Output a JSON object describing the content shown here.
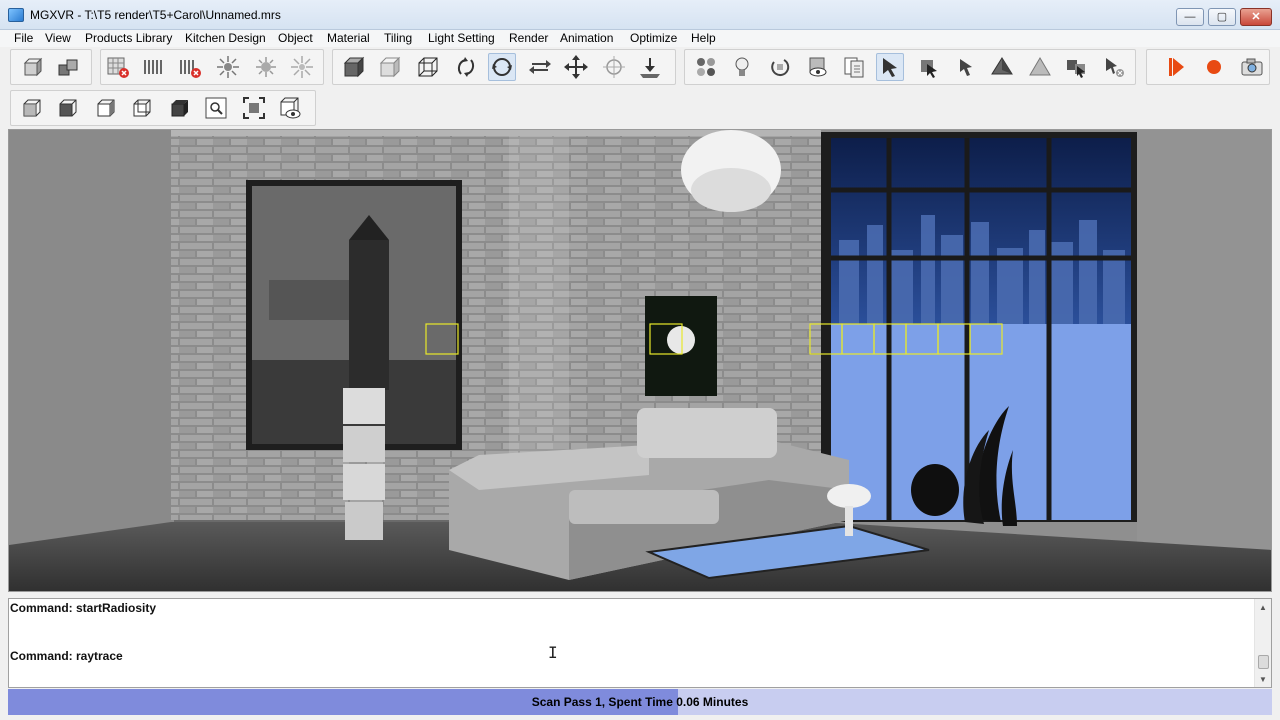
{
  "window": {
    "title": "MGXVR - T:\\T5 render\\T5+Carol\\Unnamed.mrs",
    "minimize": "—",
    "restore": "▢",
    "close": "✕"
  },
  "menu": [
    "File",
    "View",
    "Products Library",
    "Kitchen Design",
    "Object",
    "Material",
    "Tiling",
    "Light Setting",
    "Render",
    "Animation",
    "Optimize",
    "Help"
  ],
  "console": {
    "lines": [
      "Command: startRadiosity",
      "Command: raytrace"
    ]
  },
  "status": {
    "text": "Scan Pass 1, Spent Time 0.06 Minutes",
    "progress": 0.53
  },
  "colors": {
    "status_fill": "#7f8bdc",
    "status_bg": "#c8cdf0",
    "selection_box": "#e8e82a",
    "render_stop": "#e84a12"
  }
}
